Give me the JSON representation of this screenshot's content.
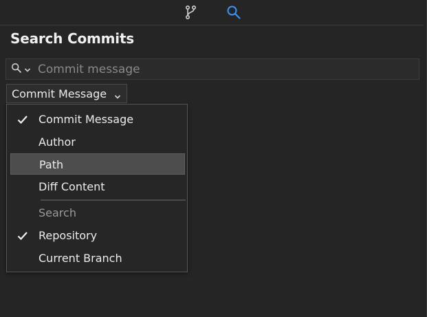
{
  "toolbar": {
    "icons": [
      "git-branch-icon",
      "search-icon"
    ],
    "active_icon": "search-icon",
    "accent_color": "#3794ff"
  },
  "panel": {
    "title": "Search Commits"
  },
  "search": {
    "scope_icon": "search-icon",
    "placeholder": "Commit message",
    "value": ""
  },
  "filter_combo": {
    "selected": "Commit Message"
  },
  "dropdown": {
    "items": [
      {
        "label": "Commit Message",
        "checked": true,
        "highlighted": false
      },
      {
        "label": "Author",
        "checked": false,
        "highlighted": false
      },
      {
        "label": "Path",
        "checked": false,
        "highlighted": true
      },
      {
        "label": "Diff Content",
        "checked": false,
        "highlighted": false
      }
    ],
    "section_header": "Search",
    "scope_items": [
      {
        "label": "Repository",
        "checked": true
      },
      {
        "label": "Current Branch",
        "checked": false
      }
    ]
  }
}
